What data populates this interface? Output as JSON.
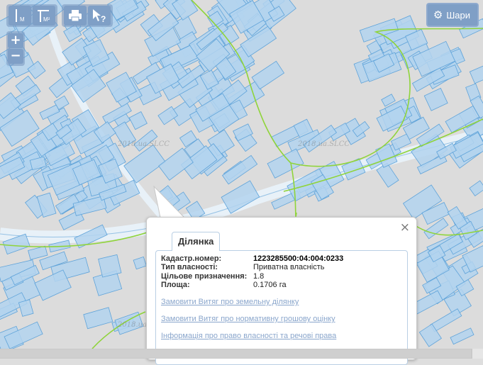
{
  "toolbar": {
    "tools": [
      {
        "name": "measure-length-tool",
        "icon": "ruler-m-icon",
        "unit_label": "М"
      },
      {
        "name": "measure-area-tool",
        "icon": "ruler-area-icon",
        "unit_label": "М²"
      },
      {
        "name": "print-tool",
        "icon": "printer-icon"
      },
      {
        "name": "identify-tool",
        "icon": "cursor-question-icon",
        "glyph": "?"
      }
    ],
    "zoom_in_label": "+",
    "zoom_out_label": "−",
    "layers_label": "Шари",
    "layers_icon": "gear-icon"
  },
  "map": {
    "watermarks": [
      "2018.ua.SLCC",
      "2018.ua.SLCC",
      "2018.ua.SLCC"
    ],
    "parcel_fill": "#b3d4ee",
    "parcel_stroke": "#5fa3d9",
    "boundary_color": "#8fd43a",
    "background": "#dcdcdc"
  },
  "popup": {
    "close_label": "×",
    "tab_label": "Ділянка",
    "attributes": [
      {
        "label": "Кадастр.номер:",
        "value": "1223285500:04:004:0233",
        "strong": true
      },
      {
        "label": "Тип власності:",
        "value": "Приватна власність",
        "strong": false
      },
      {
        "label": "Цільове призначення:",
        "value": "1.8",
        "strong": false
      },
      {
        "label": "Площа:",
        "value": "0.1706 га",
        "strong": false
      }
    ],
    "links": [
      "Замовити Витяг про земельну ділянку",
      "Замовити Витяг про нормативну грошову оцінку",
      "Інформація про право власності та речові права"
    ]
  }
}
